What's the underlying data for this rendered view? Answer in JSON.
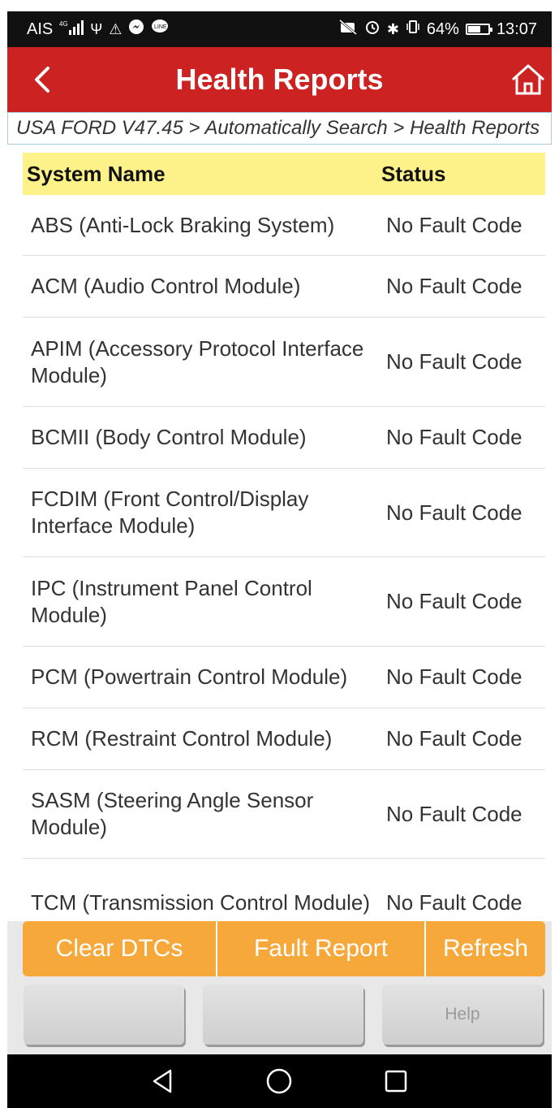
{
  "status_bar": {
    "carrier": "AIS",
    "network": "4G",
    "battery": "64%",
    "battery_level": 0.64,
    "time": "13:07",
    "icons": [
      "signal-icon",
      "usb-icon",
      "warning-icon",
      "messenger-icon",
      "line-icon",
      "mute-icon",
      "alarm-icon",
      "bluetooth-icon",
      "vibrate-icon",
      "battery-icon"
    ]
  },
  "header": {
    "title": "Health Reports",
    "back_icon": "back-arrow-icon",
    "home_icon": "home-icon",
    "accent_color": "#cc2222"
  },
  "breadcrumb": "USA FORD V47.45 > Automatically Search > Health Reports",
  "table": {
    "columns": [
      "System Name",
      "Status"
    ],
    "header_color": "#fdf28a",
    "rows": [
      {
        "name": "ABS (Anti-Lock Braking System)",
        "status": "No Fault Code"
      },
      {
        "name": "ACM (Audio Control Module)",
        "status": "No Fault Code"
      },
      {
        "name": "APIM (Accessory Protocol Interface Module)",
        "status": "No Fault Code"
      },
      {
        "name": "BCMII (Body Control Module)",
        "status": "No Fault Code"
      },
      {
        "name": "FCDIM (Front Control/Display Interface Module)",
        "status": "No Fault Code"
      },
      {
        "name": "IPC (Instrument Panel Control Module)",
        "status": "No Fault Code"
      },
      {
        "name": "PCM (Powertrain Control Module)",
        "status": "No Fault Code"
      },
      {
        "name": "RCM (Restraint Control Module)",
        "status": "No Fault Code"
      },
      {
        "name": "SASM (Steering Angle Sensor Module)",
        "status": "No Fault Code"
      },
      {
        "name": "TCM (Transmission Control Module)",
        "status": "No Fault Code"
      }
    ]
  },
  "actions": {
    "clear_dtcs": "Clear DTCs",
    "fault_report": "Fault Report",
    "refresh": "Refresh",
    "button_color": "#f7a83a",
    "gray_buttons": [
      "",
      "",
      "Help"
    ]
  },
  "nav": [
    "back-triangle-icon",
    "home-circle-icon",
    "recents-square-icon"
  ]
}
